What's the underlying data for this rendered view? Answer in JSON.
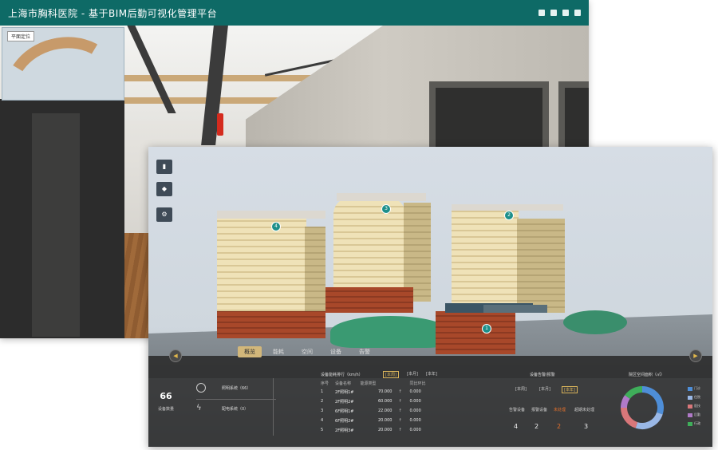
{
  "back_window": {
    "title": "上海市胸科医院 - 基于BIM后勤可视化管理平台",
    "minimap_label": "平面定位"
  },
  "nav_tabs": [
    {
      "label": "概览",
      "active": true
    },
    {
      "label": "能耗",
      "active": false
    },
    {
      "label": "空间",
      "active": false
    },
    {
      "label": "设备",
      "active": false
    },
    {
      "label": "告警",
      "active": false
    }
  ],
  "building_pins": [
    "4",
    "3",
    "2",
    "1"
  ],
  "device_total": {
    "value": "66",
    "label": "设备数量"
  },
  "systems": [
    {
      "icon": "bulb-icon",
      "label": "照明系统（66）"
    },
    {
      "icon": "lightning-icon",
      "label": "配电系统（0）"
    }
  ],
  "device_ranking": {
    "title": "设备能耗排行（km/h）",
    "chips": [
      "[本周]",
      "[本月]",
      "[本年]"
    ],
    "columns": [
      "序号",
      "设备名称",
      "能源类型",
      "同比环比"
    ],
    "rows": [
      {
        "no": "1",
        "name": "2F照明1#",
        "speed": "70.000",
        "ratio": "0.000"
      },
      {
        "no": "2",
        "name": "2F照明2#",
        "speed": "60.000",
        "ratio": "0.000"
      },
      {
        "no": "3",
        "name": "6F照明1#",
        "speed": "22.000",
        "ratio": "0.000"
      },
      {
        "no": "4",
        "name": "6F照明2#",
        "speed": "20.000",
        "ratio": "0.000"
      },
      {
        "no": "5",
        "name": "2F照明3#",
        "speed": "20.000",
        "ratio": "0.000"
      }
    ]
  },
  "alarm": {
    "title": "设备告警/报警",
    "chips": [
      "[本周]",
      "[本月]",
      "[本年]"
    ],
    "items": [
      {
        "label": "告警设备",
        "value": "4",
        "warn": false
      },
      {
        "label": "报警设备",
        "value": "2",
        "warn": false
      },
      {
        "label": "未处理",
        "value": "2",
        "warn": true
      },
      {
        "label": "超期未处理",
        "value": "3",
        "warn": false
      }
    ]
  },
  "space": {
    "title": "院区空间面积（㎡）",
    "legend": [
      {
        "label": "门诊",
        "color": "#4e8ed8",
        "value": 30
      },
      {
        "label": "住院",
        "color": "#9ab8e6",
        "value": 25
      },
      {
        "label": "医技",
        "color": "#d9777a",
        "value": 20
      },
      {
        "label": "后勤",
        "color": "#b07ac8",
        "value": 10
      },
      {
        "label": "行政",
        "color": "#3fae5a",
        "value": 15
      }
    ]
  },
  "colors": {
    "titlebar": "#0e6a66",
    "accent": "#d2b77a",
    "warn": "#e4702c"
  }
}
